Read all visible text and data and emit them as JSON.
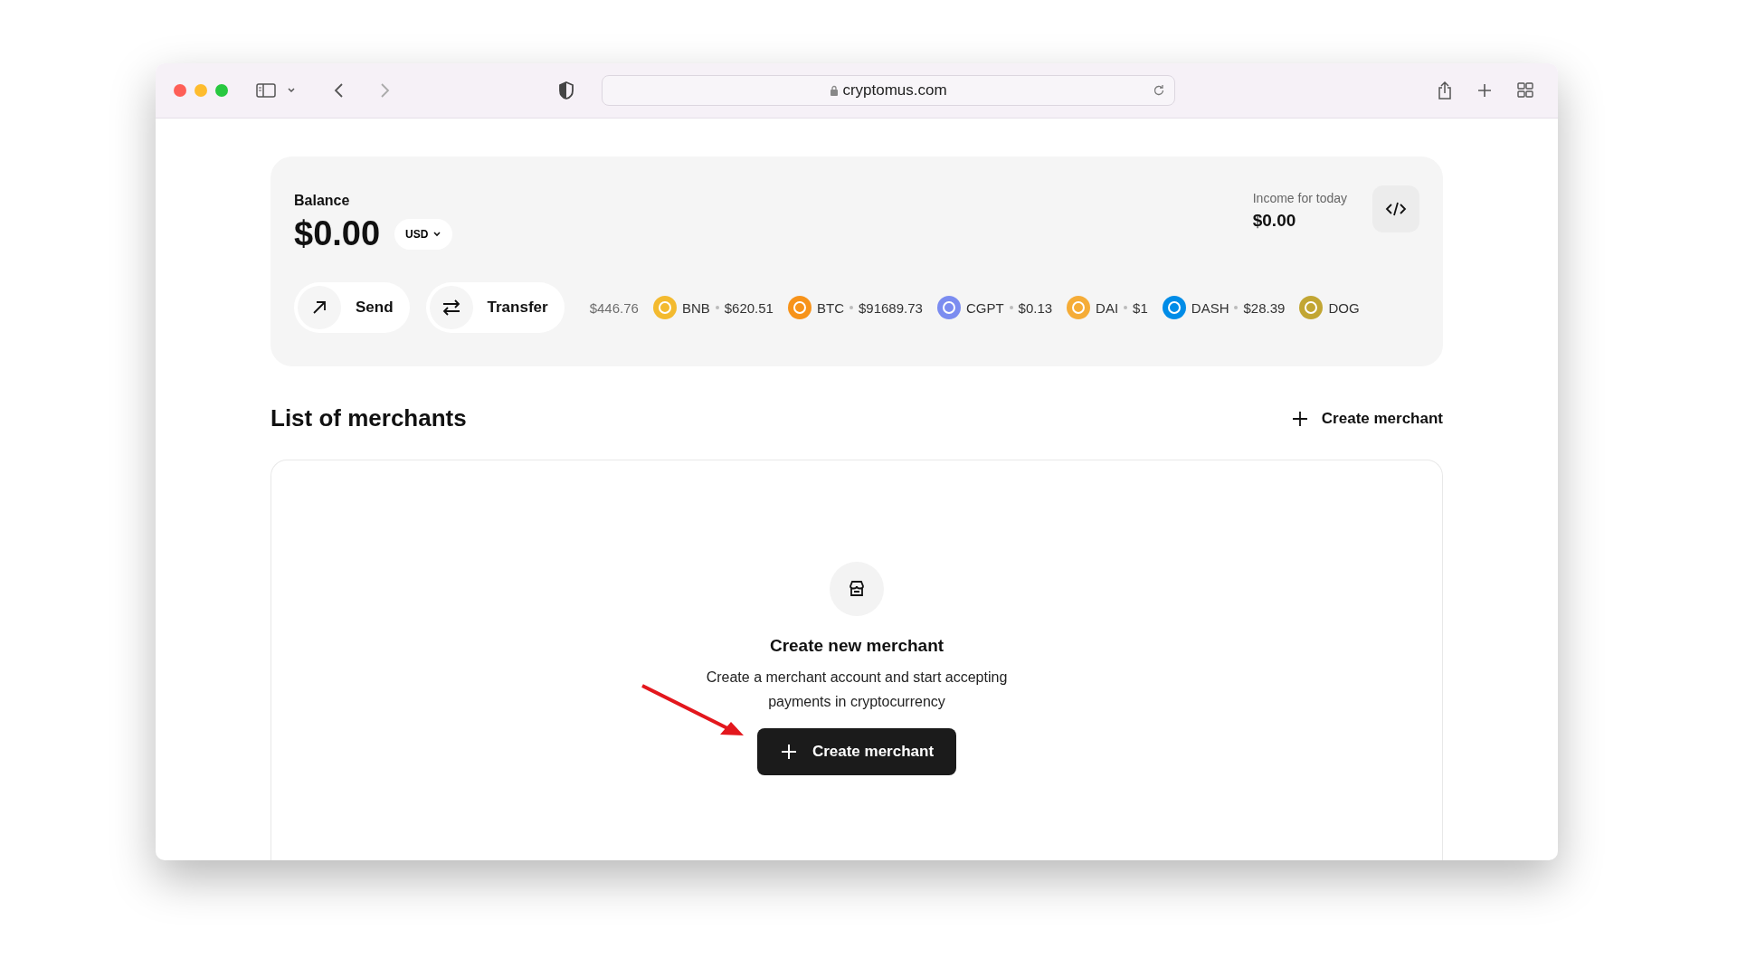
{
  "browser": {
    "url": "cryptomus.com"
  },
  "balance": {
    "label": "Balance",
    "amount": "$0.00",
    "currency": "USD",
    "income_label": "Income for today",
    "income": "$0.00"
  },
  "actions": [
    {
      "kind": "send",
      "label": "Send"
    },
    {
      "kind": "transfer",
      "label": "Transfer"
    }
  ],
  "ticker": [
    {
      "price": "$446.76"
    },
    {
      "symbol": "BNB",
      "price": "$620.51",
      "color": "#f3ba2f"
    },
    {
      "symbol": "BTC",
      "price": "$91689.73",
      "color": "#f7931a"
    },
    {
      "symbol": "CGPT",
      "price": "$0.13",
      "color": "#7b8cf0"
    },
    {
      "symbol": "DAI",
      "price": "$1",
      "color": "#f5ac37"
    },
    {
      "symbol": "DASH",
      "price": "$28.39",
      "color": "#008ce7"
    },
    {
      "symbol": "DOG",
      "color": "#c2a633"
    }
  ],
  "merchants": {
    "title": "List of merchants",
    "create_link": "Create merchant",
    "empty_title": "Create new merchant",
    "empty_text": "Create a merchant account and start accepting payments in cryptocurrency",
    "create_button": "Create merchant"
  }
}
